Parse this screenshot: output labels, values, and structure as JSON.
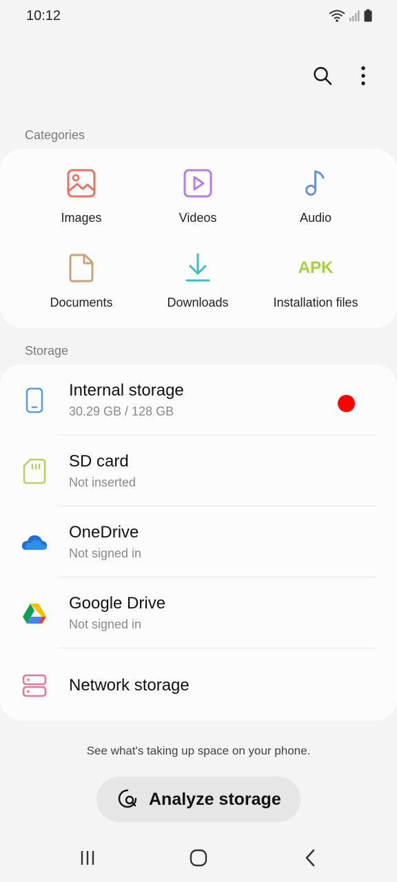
{
  "status_bar": {
    "time": "10:12"
  },
  "toolbar": {
    "search_icon": "search-icon",
    "more_icon": "more-vertical-icon"
  },
  "categories": {
    "title": "Categories",
    "items": [
      {
        "label": "Images",
        "icon": "image-icon",
        "color": "#e5735e"
      },
      {
        "label": "Videos",
        "icon": "video-icon",
        "color": "#b97ce0"
      },
      {
        "label": "Audio",
        "icon": "music-note-icon",
        "color": "#6a8fdc"
      },
      {
        "label": "Documents",
        "icon": "document-icon",
        "color": "#c9a27a"
      },
      {
        "label": "Downloads",
        "icon": "download-icon",
        "color": "#3cbcc4"
      },
      {
        "label": "Installation files",
        "icon": "apk-icon",
        "icon_text": "APK",
        "color": "#a6d13e"
      }
    ]
  },
  "storage": {
    "title": "Storage",
    "items": [
      {
        "title": "Internal storage",
        "subtitle": "30.29 GB / 128 GB",
        "icon": "phone-icon"
      },
      {
        "title": "SD card",
        "subtitle": "Not inserted",
        "icon": "sd-card-icon"
      },
      {
        "title": "OneDrive",
        "subtitle": "Not signed in",
        "icon": "onedrive-icon"
      },
      {
        "title": "Google Drive",
        "subtitle": "Not signed in",
        "icon": "google-drive-icon"
      },
      {
        "title": "Network storage",
        "subtitle": "",
        "icon": "network-storage-icon"
      }
    ]
  },
  "hint": "See what's taking up space on your phone.",
  "analyze_button": {
    "label": "Analyze storage",
    "icon": "analyze-storage-icon"
  },
  "nav": {
    "recents": "recents-icon",
    "home": "home-icon",
    "back": "back-icon"
  }
}
